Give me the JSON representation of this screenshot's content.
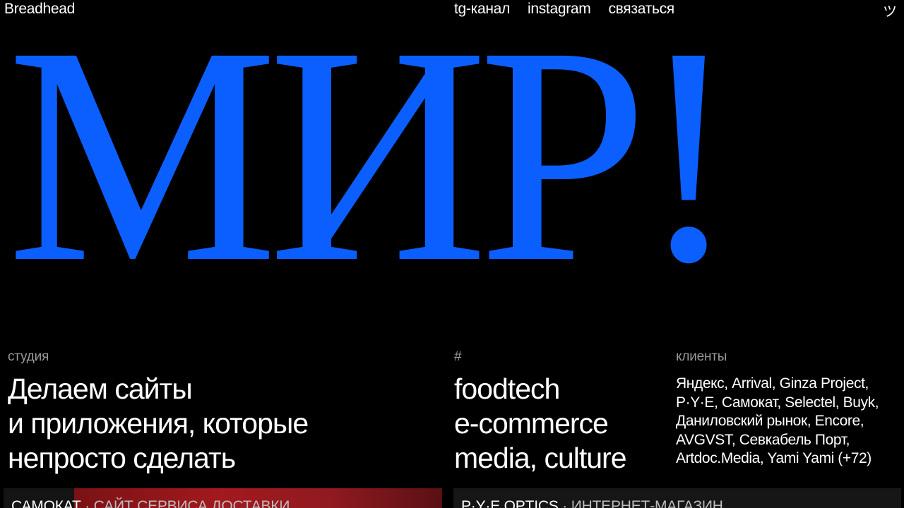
{
  "header": {
    "logo": "Breadhead",
    "nav": [
      "tg-канал",
      "instagram",
      "связаться"
    ],
    "smile_icon": "ツ"
  },
  "hero": {
    "word": "МИР!",
    "color": "#0b5fff"
  },
  "studio": {
    "label": "студия",
    "lines": [
      "Делаем сайты",
      "и приложения, которые",
      "непросто сделать"
    ]
  },
  "tags": {
    "label": "#",
    "lines": [
      "foodtech",
      "e-commerce",
      "media, culture"
    ]
  },
  "clients": {
    "label": "клиенты",
    "lines": [
      "Яндекс, Arrival, Ginza Project,",
      "P·Y·E, Самокат, Selectel, Buyk,",
      "Даниловский рынок, Encore,",
      "AVGVST, Севкабель Порт,",
      "Artdoc.Media, Yami Yami (+72)"
    ]
  },
  "cards": [
    {
      "name": "САМОКАТ",
      "separator": " · ",
      "desc": "САЙТ СЕРВИСА ДОСТАВКИ"
    },
    {
      "name": "P·Y·E OPTICS",
      "separator": " · ",
      "desc": "ИНТЕРНЕТ-МАГАЗИН"
    }
  ]
}
